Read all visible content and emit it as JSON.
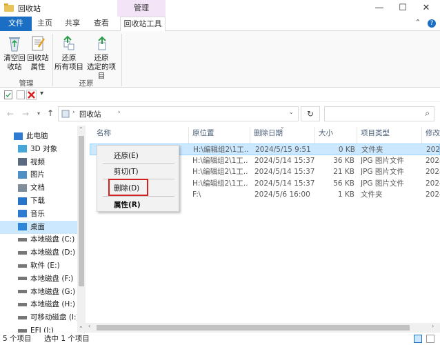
{
  "window": {
    "title": "回收站",
    "context_tab": "管理",
    "minimize": "—",
    "maximize": "☐",
    "close": "✕"
  },
  "tabs": [
    "文件",
    "主页",
    "共享",
    "查看",
    "回收站工具"
  ],
  "ribbon": {
    "manage_group": {
      "label": "管理",
      "empty_bin": [
        "清空回",
        "收站"
      ],
      "bin_props": [
        "回收站",
        "属性"
      ]
    },
    "restore_group": {
      "label": "还原",
      "restore_all": [
        "还原",
        "所有项目"
      ],
      "restore_selected": [
        "还原",
        "选定的项目"
      ]
    }
  },
  "address": {
    "location": "回收站"
  },
  "nav": [
    {
      "label": "此电脑",
      "icon": "pc-icon"
    },
    {
      "label": "3D 对象",
      "icon": "3d-objects-icon"
    },
    {
      "label": "视频",
      "icon": "video-icon"
    },
    {
      "label": "图片",
      "icon": "pictures-icon"
    },
    {
      "label": "文档",
      "icon": "documents-icon"
    },
    {
      "label": "下载",
      "icon": "download-icon"
    },
    {
      "label": "音乐",
      "icon": "music-icon"
    },
    {
      "label": "桌面",
      "icon": "desktop-icon"
    },
    {
      "label": "本地磁盘 (C:)",
      "icon": "drive-icon"
    },
    {
      "label": "本地磁盘 (D:)",
      "icon": "drive-icon"
    },
    {
      "label": "软件 (E:)",
      "icon": "drive-icon"
    },
    {
      "label": "本地磁盘 (F:)",
      "icon": "drive-icon"
    },
    {
      "label": "本地磁盘 (G:)",
      "icon": "drive-icon"
    },
    {
      "label": "本地磁盘 (H:)",
      "icon": "drive-icon"
    },
    {
      "label": "可移动磁盘 (I:)",
      "icon": "drive-icon"
    },
    {
      "label": "EFI (J:)",
      "icon": "drive-icon"
    }
  ],
  "columns": [
    "名称",
    "原位置",
    "删除日期",
    "大小",
    "项目类型",
    "修改"
  ],
  "rows": [
    {
      "location": "H:\\编辑组2\\1工...",
      "date": "2024/5/15 9:51",
      "size": "0 KB",
      "type": "文件夹",
      "modified": "2024"
    },
    {
      "location": "H:\\编辑组2\\1工...",
      "date": "2024/5/14 15:37",
      "size": "36 KB",
      "type": "JPG 图片文件",
      "modified": "2024"
    },
    {
      "location": "H:\\编辑组2\\1工...",
      "date": "2024/5/14 15:37",
      "size": "21 KB",
      "type": "JPG 图片文件",
      "modified": "2024"
    },
    {
      "location": "H:\\编辑组2\\1工...",
      "date": "2024/5/14 15:37",
      "size": "56 KB",
      "type": "JPG 图片文件",
      "modified": "2024"
    },
    {
      "location": "F:\\",
      "date": "2024/5/6 16:00",
      "size": "1 KB",
      "type": "文件夹",
      "modified": "2024"
    }
  ],
  "context_menu": {
    "restore": "还原(E)",
    "cut": "剪切(T)",
    "delete": "删除(D)",
    "properties": "属性(R)"
  },
  "status": {
    "count": "5 个项目",
    "selected": "选中 1 个项目"
  }
}
